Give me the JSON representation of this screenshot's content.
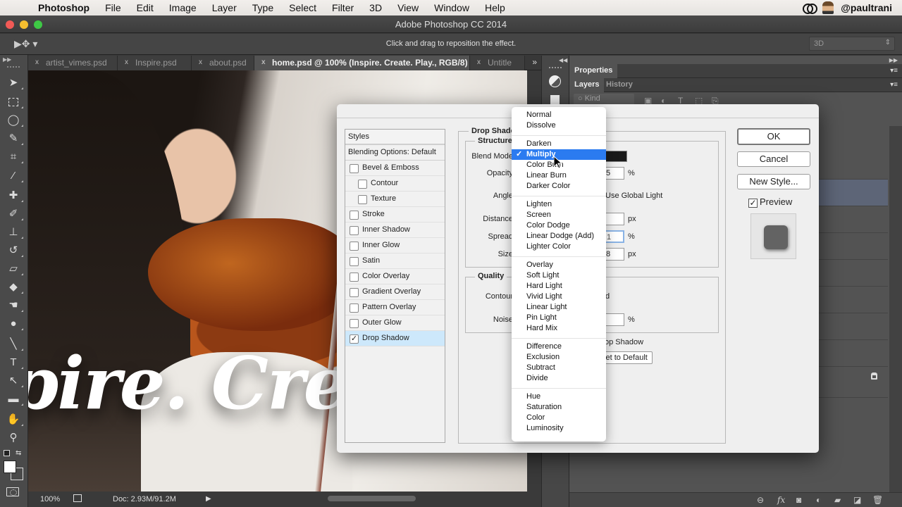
{
  "menubar": {
    "apple": "",
    "app": "Photoshop",
    "items": [
      "File",
      "Edit",
      "Image",
      "Layer",
      "Type",
      "Select",
      "Filter",
      "3D",
      "View",
      "Window",
      "Help"
    ],
    "user": "@paultrani"
  },
  "window": {
    "title": "Adobe Photoshop CC 2014"
  },
  "options": {
    "tool_glyph": "▶✥ ▾",
    "hint": "Click and drag to reposition the effect.",
    "workspace": "3D"
  },
  "tabs": {
    "items": [
      {
        "label": "artist_vimes.psd",
        "active": false
      },
      {
        "label": "Inspire.psd",
        "active": false
      },
      {
        "label": "about.psd",
        "active": false
      },
      {
        "label": "home.psd @ 100% (Inspire. Create. Play., RGB/8) *",
        "active": true
      },
      {
        "label": "Untitle",
        "active": false
      }
    ],
    "close_glyph": "x",
    "overflow": "»"
  },
  "canvas": {
    "hero_text": "pire. Cre"
  },
  "status": {
    "zoom": "100%",
    "doc": "Doc: 2.93M/91.2M",
    "arrow": "▶"
  },
  "panels": {
    "properties_tab": "Properties",
    "layers_tab": "Layers",
    "history_tab": "History",
    "kind_filter": "○ Kind",
    "menu_glyph": "▾≡"
  },
  "dialog": {
    "styles_header": "Styles",
    "blending_options": "Blending Options: Default",
    "effects": [
      {
        "label": "Bevel & Emboss",
        "checked": false,
        "sub": false
      },
      {
        "label": "Contour",
        "checked": false,
        "sub": true
      },
      {
        "label": "Texture",
        "checked": false,
        "sub": true
      },
      {
        "label": "Stroke",
        "checked": false,
        "sub": false
      },
      {
        "label": "Inner Shadow",
        "checked": false,
        "sub": false
      },
      {
        "label": "Inner Glow",
        "checked": false,
        "sub": false
      },
      {
        "label": "Satin",
        "checked": false,
        "sub": false
      },
      {
        "label": "Color Overlay",
        "checked": false,
        "sub": false
      },
      {
        "label": "Gradient Overlay",
        "checked": false,
        "sub": false
      },
      {
        "label": "Pattern Overlay",
        "checked": false,
        "sub": false
      },
      {
        "label": "Outer Glow",
        "checked": false,
        "sub": false
      },
      {
        "label": "Drop Shadow",
        "checked": true,
        "sub": false,
        "selected": true
      }
    ],
    "section_title": "Drop Shadow",
    "structure_title": "Structure",
    "quality_title": "Quality",
    "fields": {
      "blend_mode_label": "Blend Mode",
      "opacity_label": "Opacity",
      "opacity_value_visible": "5",
      "angle_label": "Angle",
      "global_light": "Use Global Light",
      "distance_label": "Distance",
      "distance_value_visible": "",
      "spread_label": "Spread",
      "spread_value_visible": "1",
      "size_label": "Size",
      "size_value_visible": "8",
      "contour_label": "Contour",
      "antialiased_visible": "d",
      "noise_label": "Noise",
      "noise_value_visible": "",
      "px": "px",
      "percent": "%",
      "knockout_visible": "op Shadow",
      "reset_visible": "set to Default",
      "shadow_color": "#1a1a1a"
    },
    "buttons": {
      "ok": "OK",
      "cancel": "Cancel",
      "new_style": "New Style..."
    },
    "preview_label": "Preview",
    "preview_checked": true
  },
  "blend_menu": {
    "selected": "Multiply",
    "check_glyph": "✓",
    "groups": [
      [
        "Normal",
        "Dissolve"
      ],
      [
        "Darken",
        "Multiply",
        "Color Burn",
        "Linear Burn",
        "Darker Color"
      ],
      [
        "Lighten",
        "Screen",
        "Color Dodge",
        "Linear Dodge (Add)",
        "Lighter Color"
      ],
      [
        "Overlay",
        "Soft Light",
        "Hard Light",
        "Vivid Light",
        "Linear Light",
        "Pin Light",
        "Hard Mix"
      ],
      [
        "Difference",
        "Exclusion",
        "Subtract",
        "Divide"
      ],
      [
        "Hue",
        "Saturation",
        "Color",
        "Luminosity"
      ]
    ]
  },
  "colors": {
    "menu_highlight": "#2b7bf0",
    "style_selected": "#cde8fb",
    "layer_selected": "#5d6577"
  }
}
